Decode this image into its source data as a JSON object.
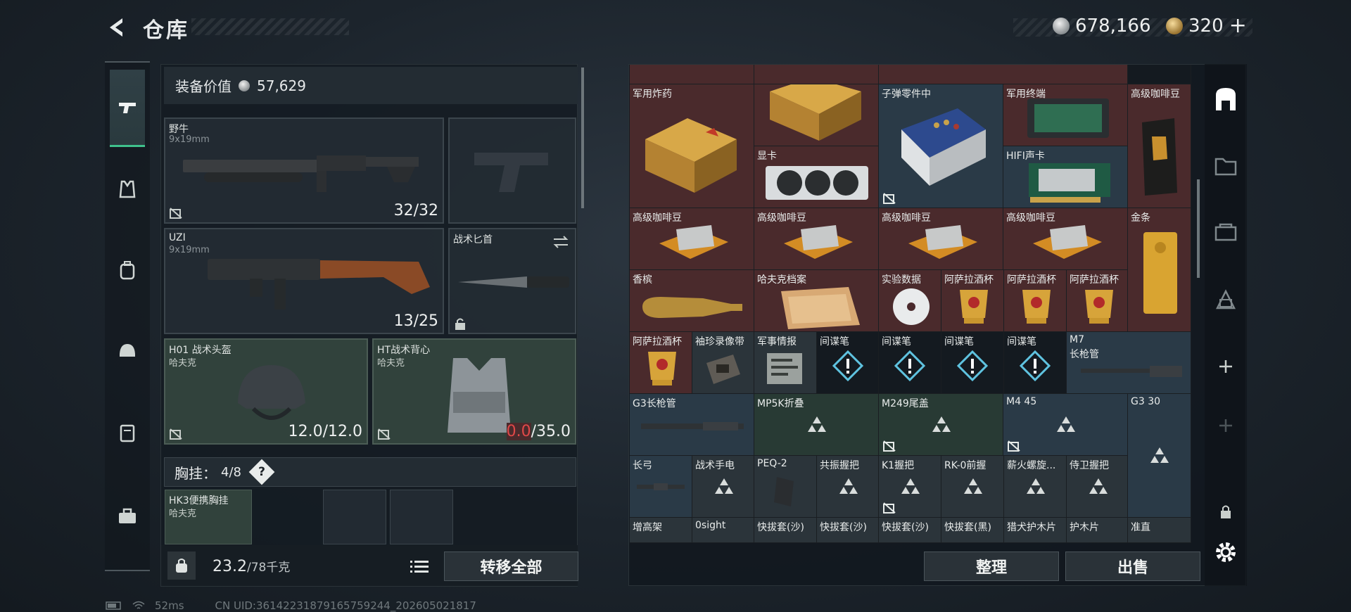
{
  "header": {
    "title": "仓库",
    "silver": "678,166",
    "gold": "320"
  },
  "gear_value": {
    "label": "装备价值",
    "value": "57,629"
  },
  "loadout": {
    "primary": {
      "name": "野牛",
      "ammo": "9x19mm",
      "count": "32/32"
    },
    "primary2": {
      "name": "UZI",
      "ammo": "9x19mm",
      "count": "13/25"
    },
    "knife": {
      "name": "战术匕首"
    },
    "helmet": {
      "name": "H01 战术头盔",
      "brand": "哈夫克",
      "dura": "12.0/12.0"
    },
    "vest": {
      "name": "HT战术背心",
      "brand": "哈夫克",
      "dura_cur": "0.0",
      "dura_max": "/35.0"
    },
    "chest": {
      "label": "胸挂：",
      "count": "4/8",
      "help": "?"
    },
    "rig": {
      "name": "HK3便携胸挂",
      "brand": "哈夫克"
    }
  },
  "weight": {
    "value": "23.2",
    "unit": "/78千克"
  },
  "buttons": {
    "transfer_all": "转移全部",
    "sort": "整理",
    "sell": "出售"
  },
  "items": {
    "military_explosive": "军用炸药",
    "bullet_parts": "子弹零件中",
    "military_terminal": "军用终端",
    "coffee": "高级咖啡豆",
    "gpu": "显卡",
    "hifi_card": "HIFI声卡",
    "gold_bar": "金条",
    "champagne": "香槟",
    "havoc_file": "哈夫克档案",
    "experiment_data": "实验数据",
    "cup": "阿萨拉酒杯",
    "mini_tape": "袖珍录像带",
    "intel": "军事情报",
    "spy_pen": "间谍笔",
    "m7_barrel": "M7",
    "m7_barrel_sub": "长枪管",
    "g3_barrel": "G3长枪管",
    "mp5k": "MP5K折叠",
    "m249": "M249尾盖",
    "m4_45": "M4 45",
    "g3_30": "G3 30",
    "longbow": "长弓",
    "flashlight": "战术手电",
    "peq2": "PEQ-2",
    "grip1": "共振握把",
    "k1grip": "K1握把",
    "rk0": "RK-0前握",
    "suppressor": "薪火螺旋...",
    "grip2": "侍卫握把",
    "riser": "增高架",
    "osight": "0sight",
    "holster_sand1": "快拔套(沙)",
    "holster_sand2": "快拔套(沙)",
    "holster_sand3": "快拔套(沙)",
    "holster_black": "快拔套(黑)",
    "handguard_hound": "猎犬护木片",
    "handguard": "护木片",
    "straight": "准直"
  },
  "status": {
    "ping": "52ms",
    "uid": "CN UID:3614223187916575924​4_202605021817"
  },
  "colors": {
    "accent_green": "#3fc28c",
    "item_red": "#4a2a2c",
    "item_blue": "#2a3a47",
    "durability_low": "#e04848"
  }
}
